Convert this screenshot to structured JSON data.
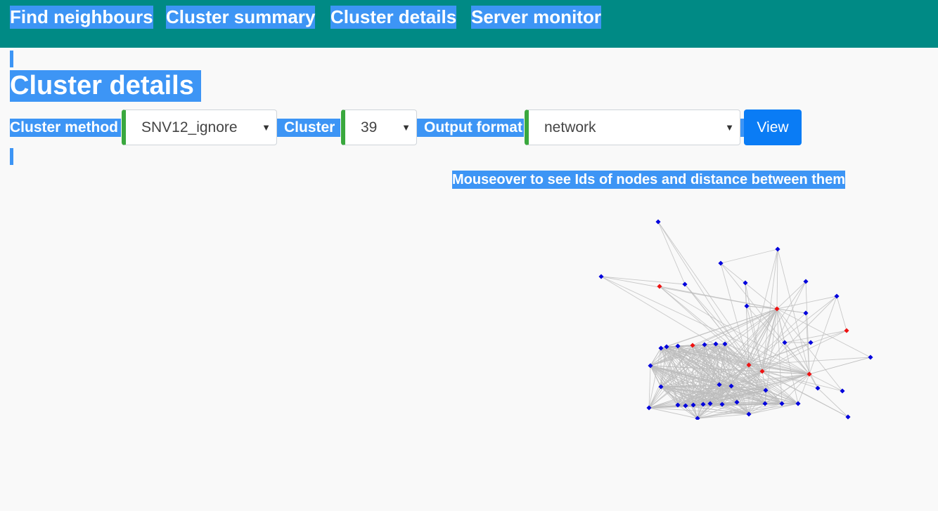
{
  "navbar": {
    "items": [
      {
        "label": "Find neighbours"
      },
      {
        "label": "Cluster summary"
      },
      {
        "label": "Cluster details"
      },
      {
        "label": "Server monitor"
      }
    ],
    "background": "#008a85"
  },
  "page": {
    "title": "Cluster details",
    "hint": "Mouseover to see Ids of nodes and distance between them"
  },
  "controls": {
    "cluster_method_label": "Cluster method",
    "cluster_method_value": "SNV12_ignore",
    "cluster_label": "Cluster",
    "cluster_value": "39",
    "output_format_label": "Output format",
    "output_format_value": "network",
    "view_button": "View"
  },
  "network": {
    "node_colors": {
      "normal": "#0000dd",
      "highlight": "#ee1111"
    },
    "edge_color": "#bdbdbd",
    "highlighted_node_count": 7
  }
}
